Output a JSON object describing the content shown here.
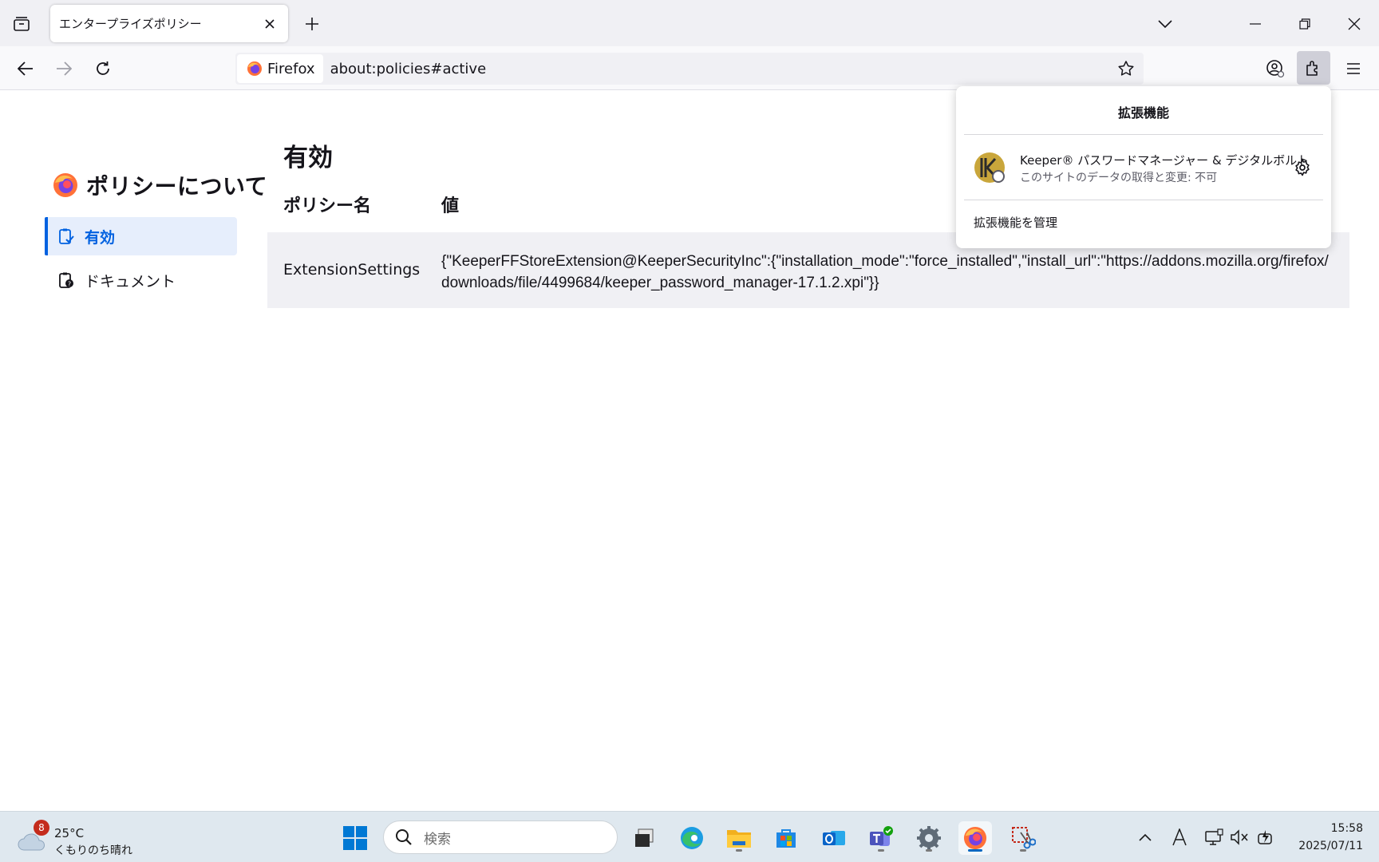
{
  "browser": {
    "tab_title": "エンタープライズポリシー",
    "identity_label": "Firefox",
    "url": "about:policies#active"
  },
  "sidebar": {
    "title": "ポリシーについて",
    "items": [
      {
        "label": "有効",
        "active": true
      },
      {
        "label": "ドキュメント",
        "active": false
      }
    ]
  },
  "main": {
    "heading": "有効",
    "columns": [
      "ポリシー名",
      "値"
    ],
    "rows": [
      {
        "name": "ExtensionSettings",
        "value": "{\"KeeperFFStoreExtension@KeeperSecurityInc\":{\"installation_mode\":\"force_installed\",\"install_url\":\"https://addons.mozilla.org/firefox/downloads/file/4499684/keeper_password_manager-17.1.2.xpi\"}}"
      }
    ]
  },
  "extensions_panel": {
    "title": "拡張機能",
    "items": [
      {
        "name": "Keeper® パスワードマネージャー & デジタルボルト",
        "permission": "このサイトのデータの取得と変更: 不可"
      }
    ],
    "manage_label": "拡張機能を管理"
  },
  "taskbar": {
    "weather_badge": "8",
    "weather_temp": "25°C",
    "weather_desc": "くもりのち晴れ",
    "search_placeholder": "検索",
    "time": "15:58",
    "date": "2025/07/11"
  },
  "colors": {
    "accent": "#0061e0",
    "active_bg": "#e6eefc",
    "row_bg": "#f0f0f4"
  }
}
